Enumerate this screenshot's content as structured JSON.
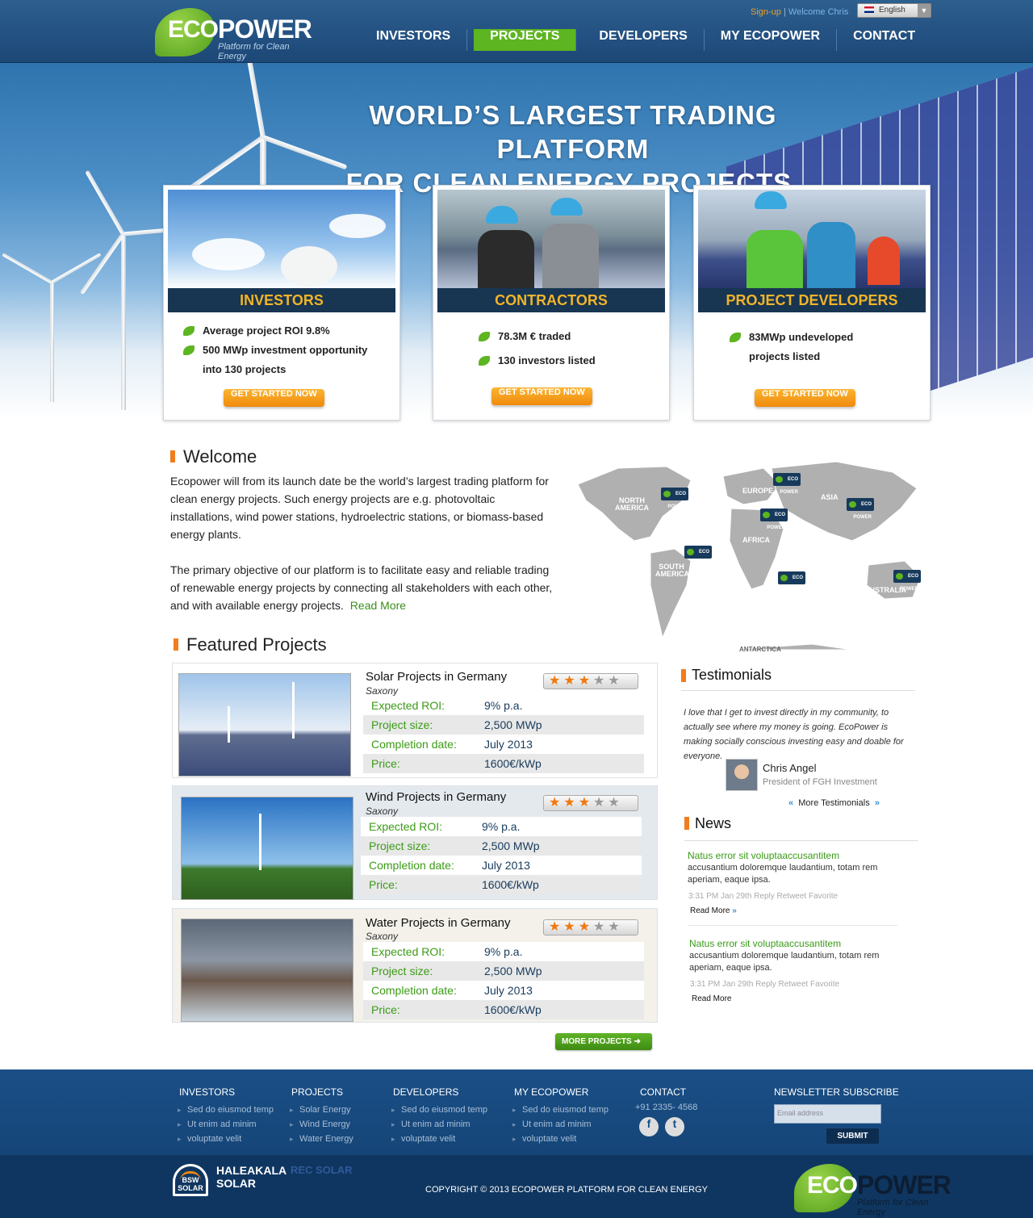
{
  "brand": {
    "eco": "ECO",
    "power": "POWER",
    "tagline": "Platform for Clean Energy"
  },
  "toplinks": {
    "signup": "Sign-up",
    "separator": "|",
    "welcome": "Welcome Chris"
  },
  "language": {
    "selected": "English"
  },
  "nav": [
    "INVESTORS",
    "PROJECTS",
    "DEVELOPERS",
    "MY ECOPOWER",
    "CONTACT"
  ],
  "hero": {
    "line1": "WORLD’S LARGEST TRADING PLATFORM",
    "line2": "FOR CLEAN ENERGY PROJECTS."
  },
  "cards": [
    {
      "title": "INVESTORS",
      "points": [
        "Average project ROI 9.8%",
        "500 MWp investment opportunity into 130 projects"
      ],
      "button": "GET STARTED NOW"
    },
    {
      "title": "CONTRACTORS",
      "points": [
        "78.3M € traded",
        "130 investors listed"
      ],
      "button": "GET STARTED NOW"
    },
    {
      "title": "PROJECT DEVELOPERS",
      "points": [
        "83MWp undeveloped projects listed"
      ],
      "button": "GET STARTED NOW"
    }
  ],
  "welcome": {
    "title": "Welcome",
    "p1": "Ecopower will from its launch date be the world’s largest trading platform for clean energy projects. Such energy projects are e.g. photovoltaic installations, wind power stations, hydroelectric stations, or biomass-based energy plants.",
    "p2": "The primary objective of our platform is to facilitate easy and reliable trading of renewable energy projects by connecting all stakeholders with each other, and with available energy projects.",
    "read_more": "Read More"
  },
  "map": {
    "labels": [
      "NORTH AMERICA",
      "EUROPE",
      "ASIA",
      "AFRICA",
      "SOUTH AMERICA",
      "AUSTRALIA",
      "ANTARCTICA"
    ],
    "pin_text": "ECO POWER"
  },
  "featured": {
    "title": "Featured Projects",
    "keys": [
      "Expected ROI:",
      "Project size:",
      "Completion date:",
      "Price:"
    ],
    "projects": [
      {
        "name": "Solar Projects in Germany",
        "region": "Saxony",
        "rating": 3,
        "values": [
          "9% p.a.",
          "2,500 MWp",
          "July 2013",
          "1600€/kWp"
        ]
      },
      {
        "name": "Wind Projects in Germany",
        "region": "Saxony",
        "rating": 3,
        "values": [
          "9% p.a.",
          "2,500 MWp",
          "July 2013",
          "1600€/kWp"
        ]
      },
      {
        "name": "Water Projects in Germany",
        "region": "Saxony",
        "rating": 3,
        "values": [
          "9% p.a.",
          "2,500 MWp",
          "July 2013",
          "1600€/kWp"
        ]
      }
    ],
    "more_button": "MORE PROJECTS"
  },
  "testimonials": {
    "title": "Testimonials",
    "quote": "I love that I get to invest directly in my community, to actually see where my money is going. EcoPower is making socially conscious investing easy and doable for everyone.",
    "author": "Chris Angel",
    "role": "President of FGH Investment",
    "more": "More Testimonials"
  },
  "news": {
    "title": "News",
    "items": [
      {
        "headline": "Natus error sit voluptaaccusantitem",
        "body": "accusantium doloremque laudantium, totam rem aperiam, eaque ipsa.",
        "meta": "3:31 PM Jan 29th Reply Retweet  Favorite",
        "more": "Read More"
      },
      {
        "headline": "Natus error sit voluptaaccusantitem",
        "body": "accusantium doloremque laudantium, totam rem aperiam, eaque ipsa.",
        "meta": "3:31 PM Jan 29th Reply Retweet  Favorite",
        "more": "Read More"
      }
    ]
  },
  "footer": {
    "columns": [
      {
        "head": "INVESTORS",
        "items": [
          "Sed do eiusmod temp",
          "Ut enim ad minim",
          "voluptate velit"
        ]
      },
      {
        "head": "PROJECTS",
        "items": [
          "Solar Energy",
          "Wind Energy",
          "Water Energy"
        ]
      },
      {
        "head": "DEVELOPERS",
        "items": [
          "Sed do eiusmod temp",
          "Ut enim ad minim",
          "voluptate velit"
        ]
      },
      {
        "head": "MY ECOPOWER",
        "items": [
          "Sed do eiusmod temp",
          "Ut enim ad minim",
          "voluptate velit"
        ]
      }
    ],
    "contact": {
      "head": "CONTACT",
      "phone": "+91 2335- 4568"
    },
    "newsletter": {
      "head": "NEWSLETTER SUBSCRIBE",
      "placeholder": "Email address",
      "submit": "SUBMIT"
    },
    "partners": [
      "BSW SOLAR",
      "HALEAKALA SOLAR",
      "REC SOLAR"
    ],
    "copyright": "COPYRIGHT © 2013 ECOPOWER PLATFORM FOR CLEAN ENERGY"
  },
  "colors": {
    "accent_green": "#5cb521",
    "accent_orange": "#f08a0c",
    "navy": "#183552"
  }
}
